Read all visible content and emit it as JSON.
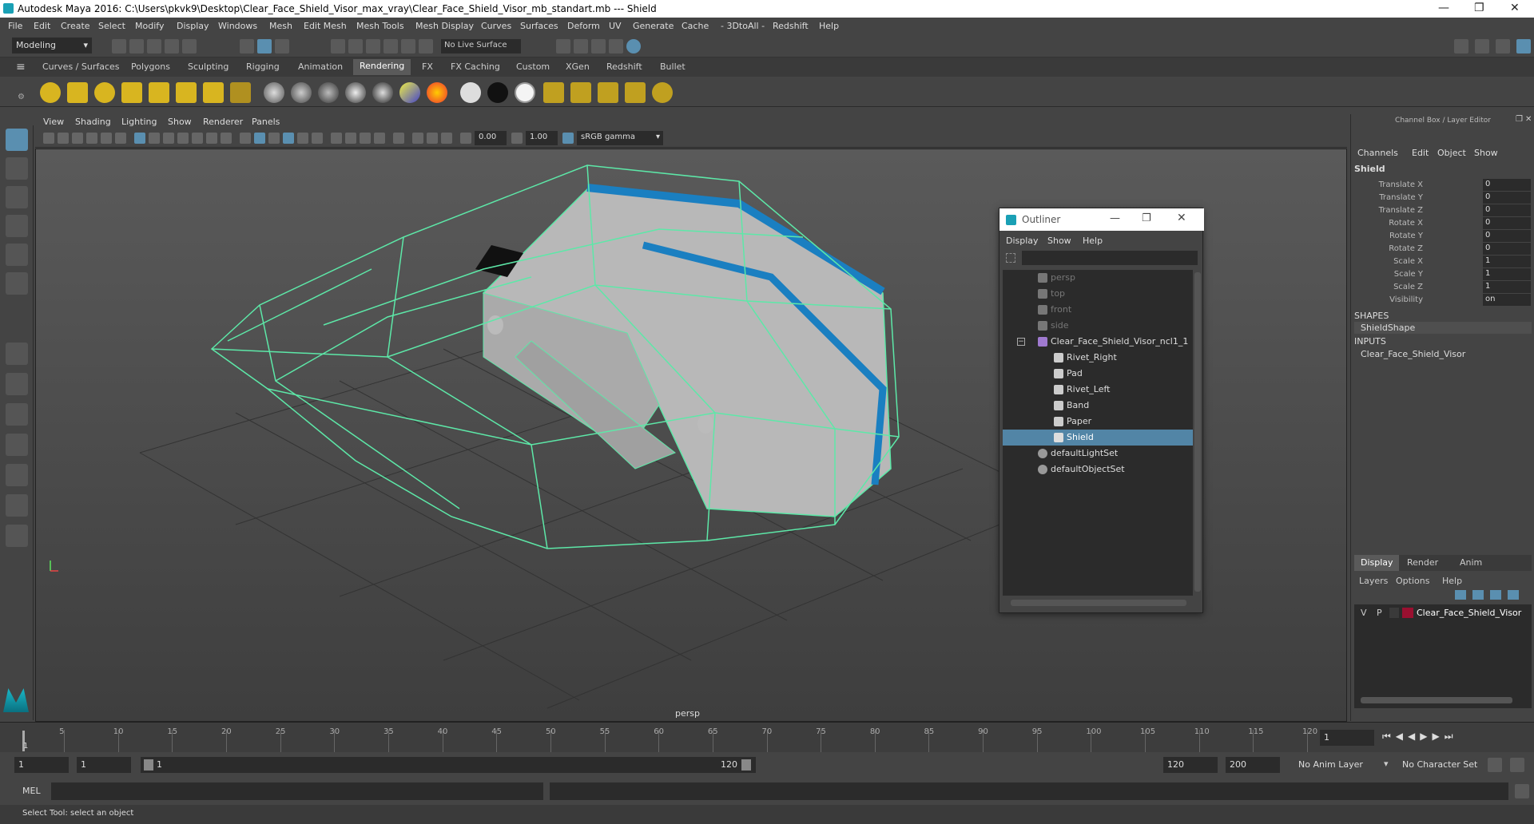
{
  "window": {
    "title": "Autodesk Maya 2016: C:\\Users\\pkvk9\\Desktop\\Clear_Face_Shield_Visor_max_vray\\Clear_Face_Shield_Visor_mb_standart.mb   ---   Shield"
  },
  "menubar": [
    "File",
    "Edit",
    "Create",
    "Select",
    "Modify",
    "Display",
    "Windows",
    "Mesh",
    "Edit Mesh",
    "Mesh Tools",
    "Mesh Display",
    "Curves",
    "Surfaces",
    "Deform",
    "UV",
    "Generate",
    "Cache",
    "- 3DtoAll -",
    "Redshift",
    "Help"
  ],
  "status": {
    "mode": "Modeling",
    "live_surface": "No Live Surface"
  },
  "shelf_tabs": [
    "Curves / Surfaces",
    "Polygons",
    "Sculpting",
    "Rigging",
    "Animation",
    "Rendering",
    "FX",
    "FX Caching",
    "Custom",
    "XGen",
    "Redshift",
    "Bullet"
  ],
  "shelf_active": "Rendering",
  "viewport": {
    "menu": [
      "View",
      "Shading",
      "Lighting",
      "Show",
      "Renderer",
      "Panels"
    ],
    "exposure": "0.00",
    "gamma": "1.00",
    "color_space": "sRGB gamma",
    "camera_label": "persp"
  },
  "outliner": {
    "title": "Outliner",
    "menu": [
      "Display",
      "Show",
      "Help"
    ],
    "items": [
      {
        "label": "persp",
        "dim": true
      },
      {
        "label": "top",
        "dim": true
      },
      {
        "label": "front",
        "dim": true
      },
      {
        "label": "side",
        "dim": true
      },
      {
        "label": "Clear_Face_Shield_Visor_ncl1_1",
        "dim": false
      },
      {
        "label": "Rivet_Right",
        "dim": false
      },
      {
        "label": "Pad",
        "dim": false
      },
      {
        "label": "Rivet_Left",
        "dim": false
      },
      {
        "label": "Band",
        "dim": false
      },
      {
        "label": "Paper",
        "dim": false
      },
      {
        "label": "Shield",
        "dim": false,
        "selected": true
      },
      {
        "label": "defaultLightSet",
        "dim": false
      },
      {
        "label": "defaultObjectSet",
        "dim": false
      }
    ]
  },
  "channelbox": {
    "header": "Channel Box / Layer Editor",
    "menu": [
      "Channels",
      "Edit",
      "Object",
      "Show"
    ],
    "object": "Shield",
    "attrs": [
      {
        "name": "Translate X",
        "value": "0"
      },
      {
        "name": "Translate Y",
        "value": "0"
      },
      {
        "name": "Translate Z",
        "value": "0"
      },
      {
        "name": "Rotate X",
        "value": "0"
      },
      {
        "name": "Rotate Y",
        "value": "0"
      },
      {
        "name": "Rotate Z",
        "value": "0"
      },
      {
        "name": "Scale X",
        "value": "1"
      },
      {
        "name": "Scale Y",
        "value": "1"
      },
      {
        "name": "Scale Z",
        "value": "1"
      },
      {
        "name": "Visibility",
        "value": "on"
      }
    ],
    "shapes_label": "SHAPES",
    "shape": "ShieldShape",
    "inputs_label": "INPUTS",
    "input": "Clear_Face_Shield_Visor",
    "layer_tabs": [
      "Display",
      "Render",
      "Anim"
    ],
    "layer_menu": [
      "Layers",
      "Options",
      "Help"
    ],
    "layer": {
      "v": "V",
      "p": "P",
      "name": "Clear_Face_Shield_Visor",
      "color": "#9a1030"
    }
  },
  "timeline": {
    "ticks": [
      5,
      10,
      15,
      20,
      25,
      30,
      35,
      40,
      45,
      50,
      55,
      60,
      65,
      70,
      75,
      80,
      85,
      90,
      95,
      100,
      105,
      110,
      115,
      120
    ],
    "current_frame": "1",
    "frame_field": "1"
  },
  "range": {
    "start": "1",
    "start2": "1",
    "slider_start": "1",
    "slider_end": "120",
    "end": "120",
    "end2": "200",
    "anim_layer": "No Anim Layer",
    "character_set": "No Character Set"
  },
  "mel_label": "MEL",
  "help_line": "Select Tool: select an object",
  "colors": {
    "wire": "#5de8a8",
    "accent": "#5285a6",
    "shield_band": "#1a7fc1"
  }
}
